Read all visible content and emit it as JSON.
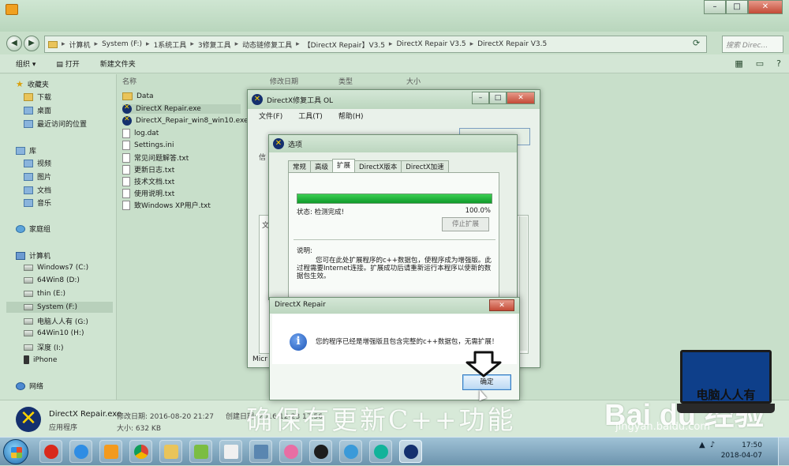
{
  "explorer": {
    "breadcrumb": [
      "计算机",
      "System (F:)",
      "1系统工具",
      "3修复工具",
      "动态链修复工具",
      "【DirectX Repair】V3.5",
      "DirectX Repair V3.5",
      "DirectX Repair V3.5"
    ],
    "search_placeholder": "搜索 Direc...",
    "toolbar": {
      "organize": "组织 ▾",
      "open": "打开",
      "new_folder": "新建文件夹"
    },
    "sidebar": {
      "favorites": "收藏夹",
      "fav_items": [
        "下载",
        "桌面",
        "最近访问的位置"
      ],
      "libraries": "库",
      "lib_items": [
        "视频",
        "图片",
        "文档",
        "音乐"
      ],
      "homegroup": "家庭组",
      "computer": "计算机",
      "drives": [
        "Windows7 (C:)",
        "64Win8 (D:)",
        "thin (E:)",
        "System (F:)",
        "电脑人人有 (G:)",
        "64Win10 (H:)",
        "深度 (I:)",
        "iPhone"
      ],
      "network": "网络"
    },
    "columns": {
      "name": "名称",
      "modified": "修改日期",
      "type": "类型",
      "size": "大小"
    },
    "files": [
      "Data",
      "DirectX Repair.exe",
      "DirectX_Repair_win8_win10.exe",
      "log.dat",
      "Settings.ini",
      "常见问题解答.txt",
      "更新日志.txt",
      "技术文档.txt",
      "使用说明.txt",
      "致Windows XP用户.txt"
    ],
    "details": {
      "name": "DirectX Repair.exe",
      "type": "应用程序",
      "modified_label": "修改日期: 2016-08-20 21:27",
      "size_label": "大小: 632 KB",
      "created_label": "创建日期: 2016-12-23 17:56"
    }
  },
  "dx_main": {
    "title": "DirectX修复工具 OL",
    "menu": [
      "文件(F)",
      "工具(T)",
      "帮助(H)"
    ],
    "ghost_labels": [
      "信",
      "文",
      "Micr"
    ]
  },
  "options": {
    "title": "选项",
    "tabs": [
      "常规",
      "高级",
      "扩展",
      "DirectX版本",
      "DirectX加速"
    ],
    "active_tab": "扩展",
    "progress_fraction": 1.0,
    "status": "状态: 检测完成!",
    "percent": "100.0%",
    "stop_button": "停止扩展",
    "note_heading": "说明:",
    "note_text": "您可在此处扩展程序的c++数据包，使程序成为增强版。此过程需要Internet连接。扩展成功后请重新运行本程序以使新的数据包生效。"
  },
  "msgbox": {
    "title": "DirectX Repair",
    "close": "✕",
    "message": "您的程序已经是增强版且包含完整的c++数据包，无需扩展！",
    "ok": "确定"
  },
  "overlay": {
    "caption": "确保有更新C++功能",
    "brand": "Bai du 经验",
    "url": "jingyan.baidu.com",
    "laptop_text": "电脑人人有"
  },
  "taskbar": {
    "time": "17:50",
    "date": "2018-04-07"
  }
}
